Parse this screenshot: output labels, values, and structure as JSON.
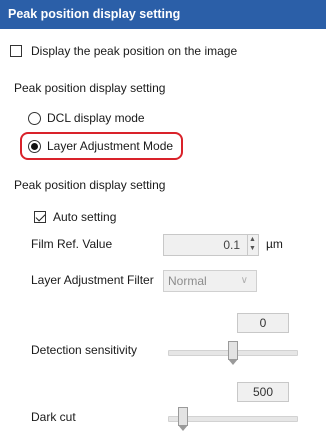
{
  "window": {
    "title": "Peak position display setting"
  },
  "display_on_image": {
    "label": "Display the peak position on the image",
    "checked": false
  },
  "section1": {
    "title": "Peak position display setting"
  },
  "mode_options": [
    {
      "label": "DCL display mode",
      "selected": false
    },
    {
      "label": "Layer Adjustment Mode",
      "selected": true
    }
  ],
  "section2": {
    "title": "Peak position display setting"
  },
  "auto_setting": {
    "label": "Auto setting",
    "checked": true
  },
  "film_ref": {
    "label": "Film Ref. Value",
    "value": "0.1",
    "unit": "µm"
  },
  "layer_filter": {
    "label": "Layer Adjustment Filter",
    "selected": "Normal"
  },
  "detection_sensitivity": {
    "label": "Detection sensitivity",
    "value": "0",
    "slider_fraction": 0.5
  },
  "dark_cut": {
    "label": "Dark cut",
    "value": "500",
    "slider_fraction": 0.08
  }
}
